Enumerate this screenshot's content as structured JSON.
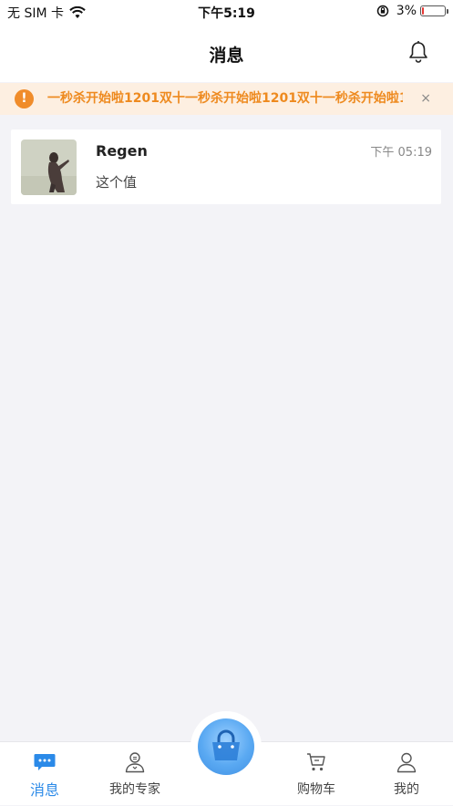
{
  "status_bar": {
    "carrier": "无 SIM 卡",
    "time": "下午5:19",
    "battery_percent": "3%",
    "battery_level": 0.03,
    "battery_color": "#e53935"
  },
  "nav": {
    "title": "消息",
    "icon": "bell-icon"
  },
  "notice": {
    "icon": "exclamation-icon",
    "text": "一秒杀开始啦1201双十一秒杀开始啦1201双十一秒杀开始啦1",
    "close": "×",
    "accent": "#ee8a1f",
    "background": "#fdefe1"
  },
  "messages": [
    {
      "name": "Regen",
      "time": "下午 05:19",
      "preview": "这个值",
      "avatar": "avatar-photo"
    }
  ],
  "tabs": [
    {
      "label": "消息",
      "icon": "chat-bubble-icon",
      "active": true
    },
    {
      "label": "我的专家",
      "icon": "expert-icon",
      "active": false
    },
    {
      "label": "购物车",
      "icon": "cart-icon",
      "active": false
    },
    {
      "label": "我的",
      "icon": "user-icon",
      "active": false
    }
  ],
  "center_button": {
    "icon": "shopping-bag-icon"
  },
  "colors": {
    "active_tab": "#2b8ae8",
    "page_background": "#f3f3f7"
  }
}
